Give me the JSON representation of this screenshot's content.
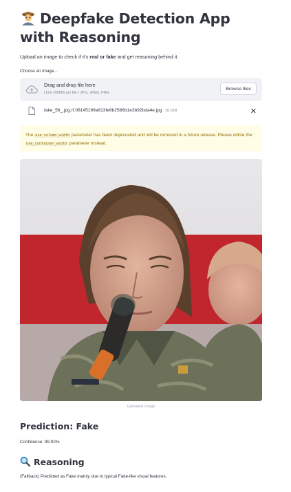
{
  "app": {
    "title": "Deepfake Detection App with Reasoning",
    "title_icon": "detective-emoji",
    "subtitle_before": "Upload an image to check if it's ",
    "subtitle_bold": "real or fake",
    "subtitle_after": " and get reasoning behind it."
  },
  "uploader": {
    "label": "Choose an image...",
    "drop_text": "Drag and drop file here",
    "limit_text": "Limit 200MB per file • JPG, JPEG, PNG",
    "browse_label": "Browse files",
    "icon": "cloud-upload-icon"
  },
  "file": {
    "name": "fake_56_.jpg.rf.08145199a613fe6b2586b1e3b92bda4e.jpg",
    "size": "10.1KB",
    "remove_symbol": "✕"
  },
  "warning": {
    "part1": "The ",
    "code1": "use_column_width",
    "part2": " parameter has been deprecated and will be removed in a future release. Please utilize the ",
    "code2": "use_container_width",
    "part3": " parameter instead."
  },
  "image": {
    "caption": "Uploaded Image",
    "colors": {
      "background_red": "#c0262c",
      "uniform": "#6d7159"
    }
  },
  "result": {
    "prediction": "Prediction: Fake",
    "confidence": "Confidence: 99.92%",
    "reasoning_heading": "Reasoning",
    "reasoning_icon": "magnifier-icon",
    "reasoning_text": "(Fallback) Predicted as Fake mainly due to typical Fake-like visual features."
  }
}
